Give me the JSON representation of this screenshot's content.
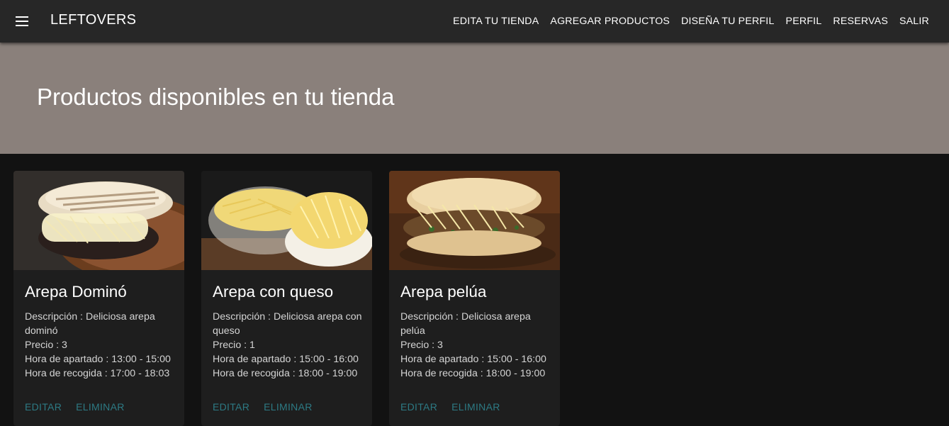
{
  "appbar": {
    "brand": "LEFTOVERS",
    "menu_icon": "hamburger-menu-icon",
    "nav": [
      "EDITA TU TIENDA",
      "AGREGAR PRODUCTOS",
      "DISEÑA TU PERFIL",
      "PERFIL",
      "RESERVAS",
      "SALIR"
    ]
  },
  "hero": {
    "title": "Productos disponibles en tu tienda"
  },
  "products": [
    {
      "name": "Arepa Dominó",
      "description": "Descripción : Deliciosa arepa dominó",
      "price": "Precio : 3",
      "reserve_time": "Hora de apartado : 13:00 - 15:00",
      "pickup_time": "Hora de recogida : 17:00 - 18:03"
    },
    {
      "name": "Arepa con queso",
      "description": "Descripción : Deliciosa arepa con queso",
      "price": "Precio : 1",
      "reserve_time": "Hora de apartado : 15:00 - 16:00",
      "pickup_time": "Hora de recogida : 18:00 - 19:00"
    },
    {
      "name": "Arepa pelúa",
      "description": "Descripción : Deliciosa arepa pelúa",
      "price": "Precio : 3",
      "reserve_time": "Hora de apartado : 15:00 - 16:00",
      "pickup_time": "Hora de recogida : 18:00 - 19:00"
    }
  ],
  "actions": {
    "edit": "EDITAR",
    "delete": "ELIMINAR"
  },
  "colors": {
    "appbar": "#272727",
    "hero": "#8a807b",
    "background": "#121212",
    "card": "#1e1e1e",
    "action": "#2d7a84"
  }
}
